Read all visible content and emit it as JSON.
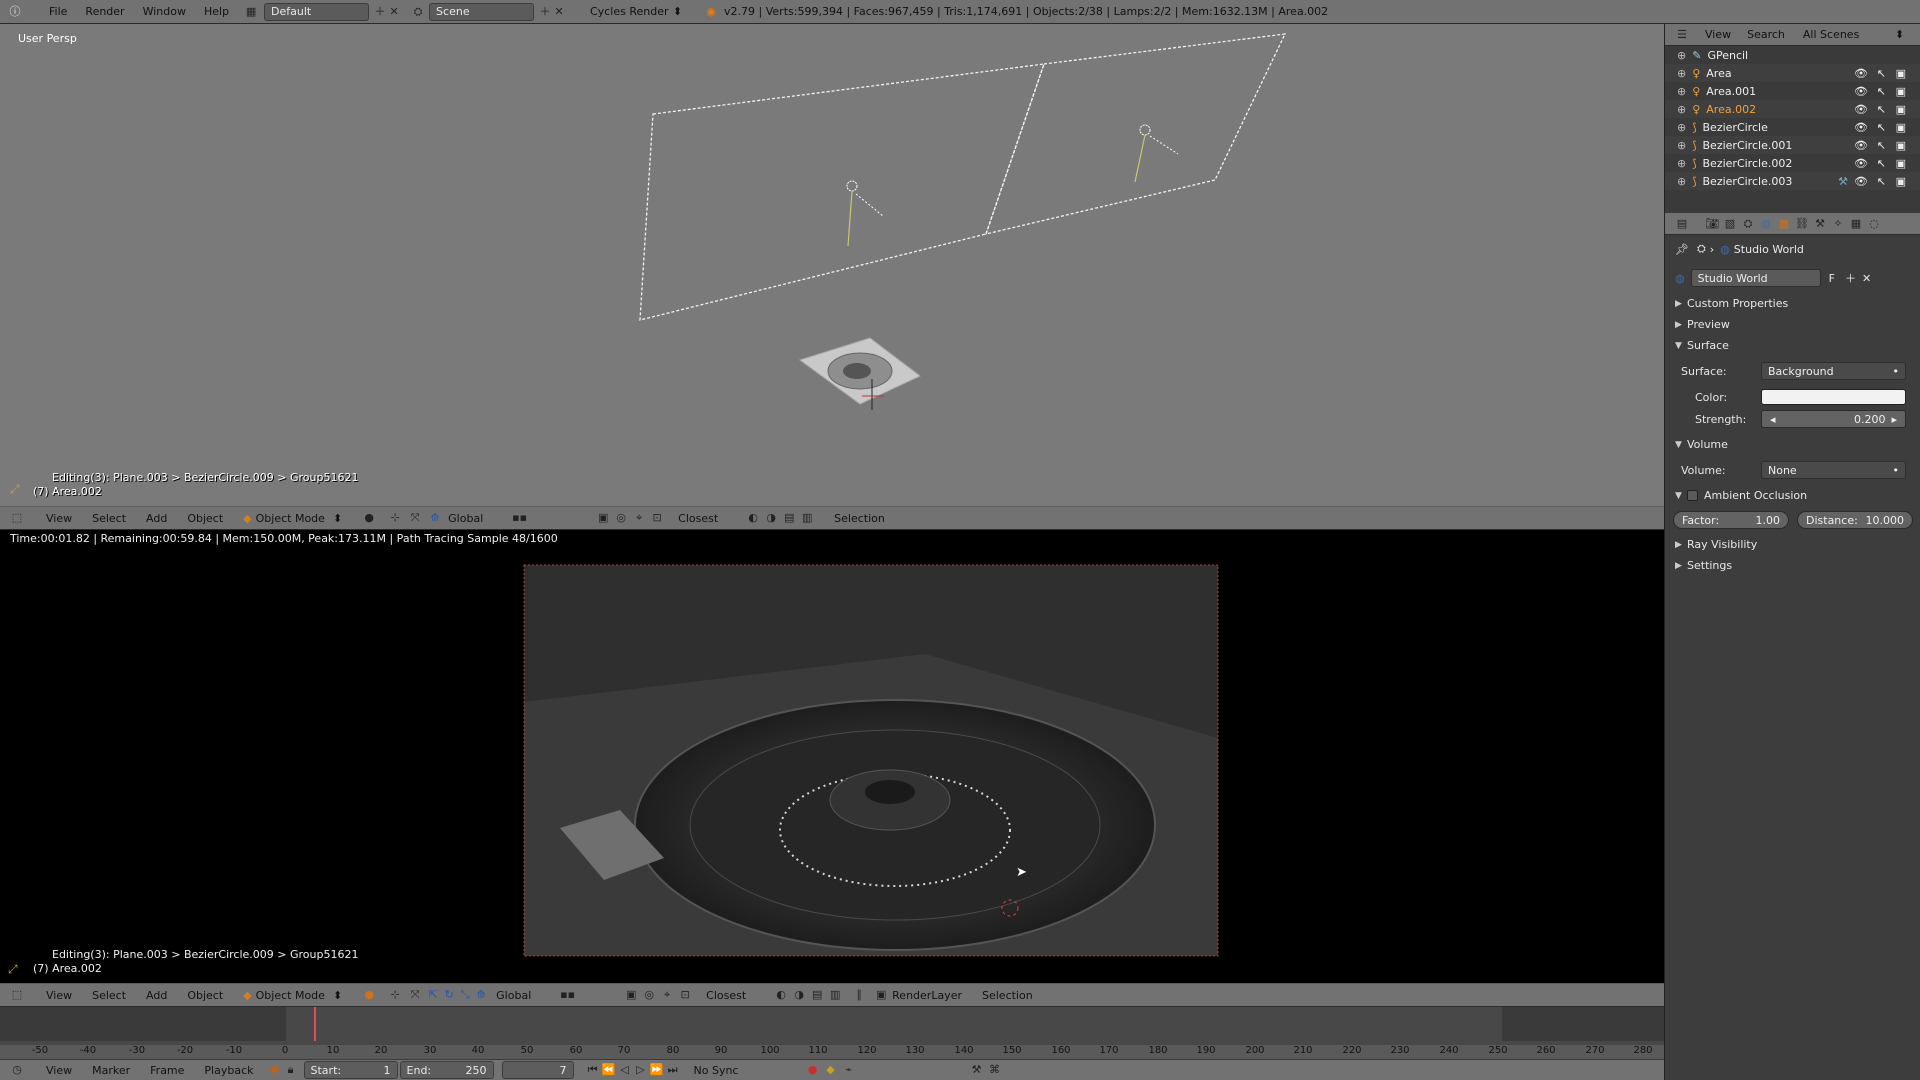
{
  "topbar": {
    "menus": [
      "File",
      "Render",
      "Window",
      "Help"
    ],
    "layout": "Default",
    "scene": "Scene",
    "engine": "Cycles Render",
    "stats": "v2.79 | Verts:599,394 | Faces:967,459 | Tris:1,174,691 | Objects:2/38 | Lamps:2/2 | Mem:1632.13M | Area.002"
  },
  "viewport3d": {
    "label": "User Persp",
    "editing": "Editing(3): Plane.003 > BezierCircle.009 > Group51621",
    "active": "(7) Area.002",
    "header": {
      "menus": [
        "View",
        "Select",
        "Add",
        "Object"
      ],
      "mode": "Object Mode",
      "orientation": "Global",
      "snap": "Closest",
      "selection": "Selection"
    }
  },
  "render_viewport": {
    "status": "Time:00:01.82 | Remaining:00:59.84 | Mem:150.00M, Peak:173.11M | Path Tracing Sample 48/1600",
    "editing": "Editing(3): Plane.003 > BezierCircle.009 > Group51621",
    "active": "(7) Area.002",
    "header": {
      "menus": [
        "View",
        "Select",
        "Add",
        "Object"
      ],
      "mode": "Object Mode",
      "orientation": "Global",
      "snap": "Closest",
      "render_layer": "RenderLayer",
      "selection": "Selection"
    }
  },
  "timeline": {
    "ticks": [
      "-50",
      "-40",
      "-30",
      "-20",
      "-10",
      "0",
      "10",
      "20",
      "30",
      "40",
      "50",
      "60",
      "70",
      "80",
      "90",
      "100",
      "110",
      "120",
      "130",
      "140",
      "150",
      "160",
      "170",
      "180",
      "190",
      "200",
      "210",
      "220",
      "230",
      "240",
      "250",
      "260",
      "270",
      "280"
    ],
    "menus": [
      "View",
      "Marker",
      "Frame",
      "Playback"
    ],
    "start_label": "Start:",
    "start": "1",
    "end_label": "End:",
    "end": "250",
    "current": "7",
    "sync": "No Sync"
  },
  "outliner": {
    "menus": [
      "View",
      "Search"
    ],
    "scope": "All Scenes",
    "items": [
      {
        "name": "GPencil",
        "color": "#e8e8e8"
      },
      {
        "name": "Area",
        "color": "#e8e8e8"
      },
      {
        "name": "Area.001",
        "color": "#e8e8e8"
      },
      {
        "name": "Area.002",
        "color": "#f0a040"
      },
      {
        "name": "BezierCircle",
        "color": "#e8e8e8"
      },
      {
        "name": "BezierCircle.001",
        "color": "#e8e8e8"
      },
      {
        "name": "BezierCircle.002",
        "color": "#e8e8e8"
      },
      {
        "name": "BezierCircle.003",
        "color": "#e8e8e8"
      }
    ]
  },
  "properties": {
    "breadcrumb": "Studio World",
    "world_name": "Studio World",
    "fake_user": "F",
    "panels": {
      "custom_properties": "Custom Properties",
      "preview": "Preview",
      "surface": "Surface",
      "volume": "Volume",
      "ambient_occlusion": "Ambient Occlusion",
      "ray_visibility": "Ray Visibility",
      "settings": "Settings"
    },
    "surface_label": "Surface:",
    "surface_value": "Background",
    "color_label": "Color:",
    "strength_label": "Strength:",
    "strength_value": "0.200",
    "volume_label": "Volume:",
    "volume_value": "None",
    "factor_label": "Factor:",
    "factor_value": "1.00",
    "distance_label": "Distance:",
    "distance_value": "10.000"
  }
}
